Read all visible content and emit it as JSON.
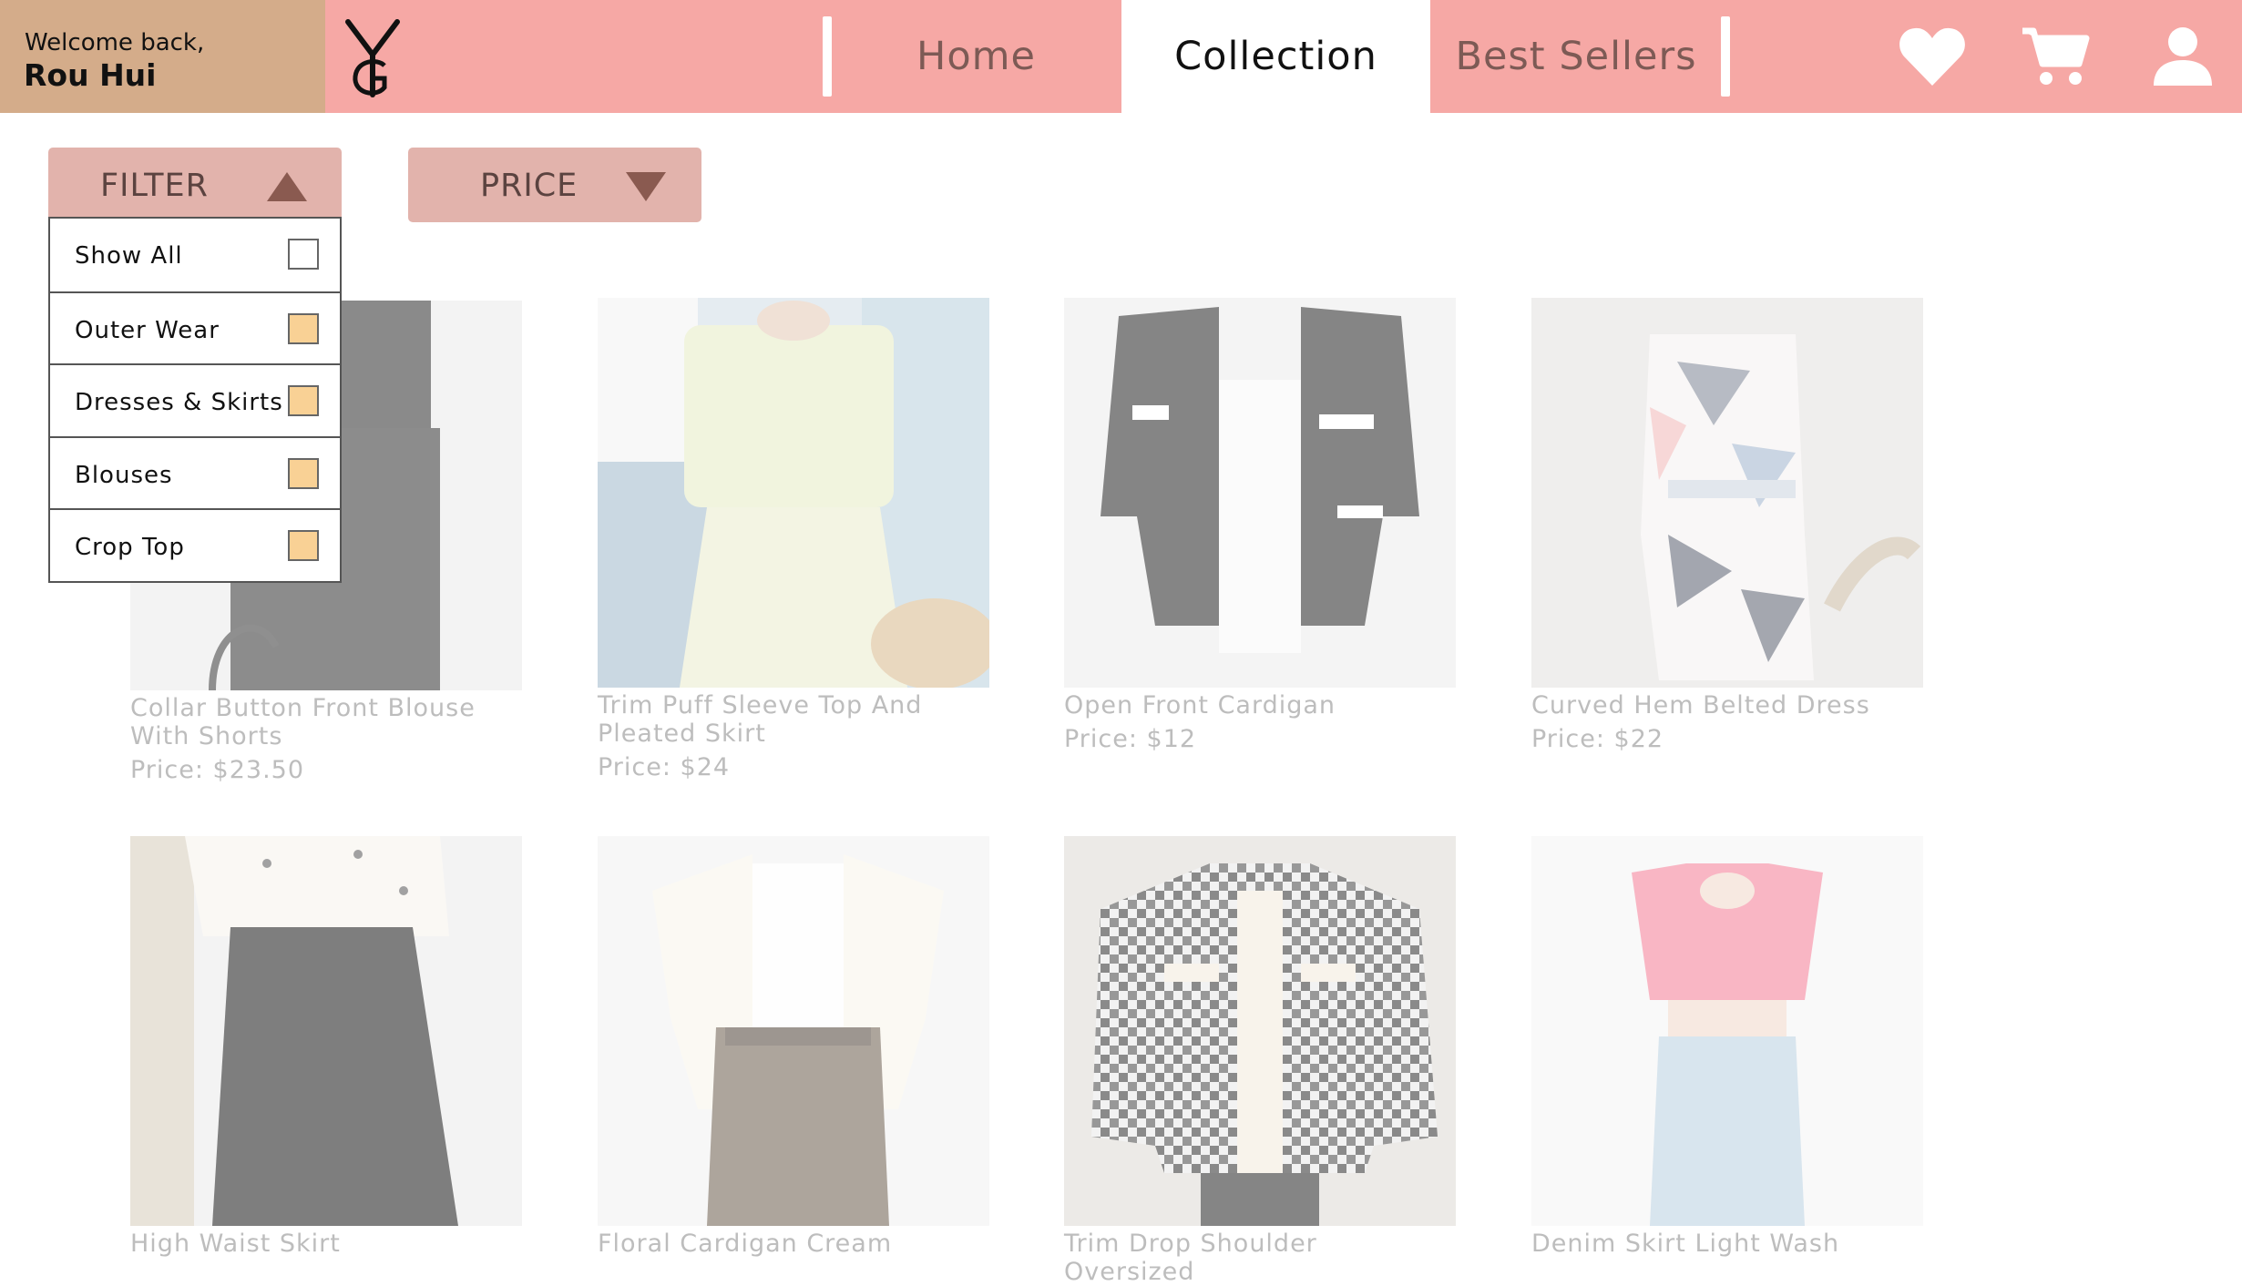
{
  "header": {
    "welcome_line1": "Welcome back,",
    "welcome_name": "Rou Hui",
    "nav": [
      {
        "label": "Home",
        "active": false
      },
      {
        "label": "Collection",
        "active": true
      },
      {
        "label": "Best Sellers",
        "active": false
      }
    ],
    "icons": [
      "heart-icon",
      "cart-icon",
      "user-icon"
    ]
  },
  "controls": {
    "filter_label": "FILTER",
    "price_label": "PRICE",
    "filter_options": [
      {
        "label": "Show All",
        "checked": false
      },
      {
        "label": "Outer Wear",
        "checked": true
      },
      {
        "label": "Dresses & Skirts",
        "checked": true
      },
      {
        "label": "Blouses",
        "checked": true
      },
      {
        "label": "Crop Top",
        "checked": true
      }
    ]
  },
  "products": [
    {
      "name": "Collar Button Front Blouse With Shorts",
      "price": "Price: $23.50"
    },
    {
      "name": "Trim Puff Sleeve Top And Pleated Skirt",
      "price": "Price: $24"
    },
    {
      "name": "Open Front Cardigan",
      "price": "Price: $12"
    },
    {
      "name": "Curved Hem Belted Dress",
      "price": "Price: $22"
    },
    {
      "name": "High Waist Skirt",
      "price": ""
    },
    {
      "name": "Floral Cardigan Cream",
      "price": ""
    },
    {
      "name": "Trim Drop Shoulder Oversized",
      "price": ""
    },
    {
      "name": "Denim Skirt Light Wash",
      "price": ""
    }
  ],
  "colors": {
    "header_bg": "#f6a8a5",
    "welcome_bg": "#d4ac8a",
    "button_bg": "#e2b3ac",
    "checkbox_on": "#f9d195",
    "caret": "#8a5a50"
  }
}
